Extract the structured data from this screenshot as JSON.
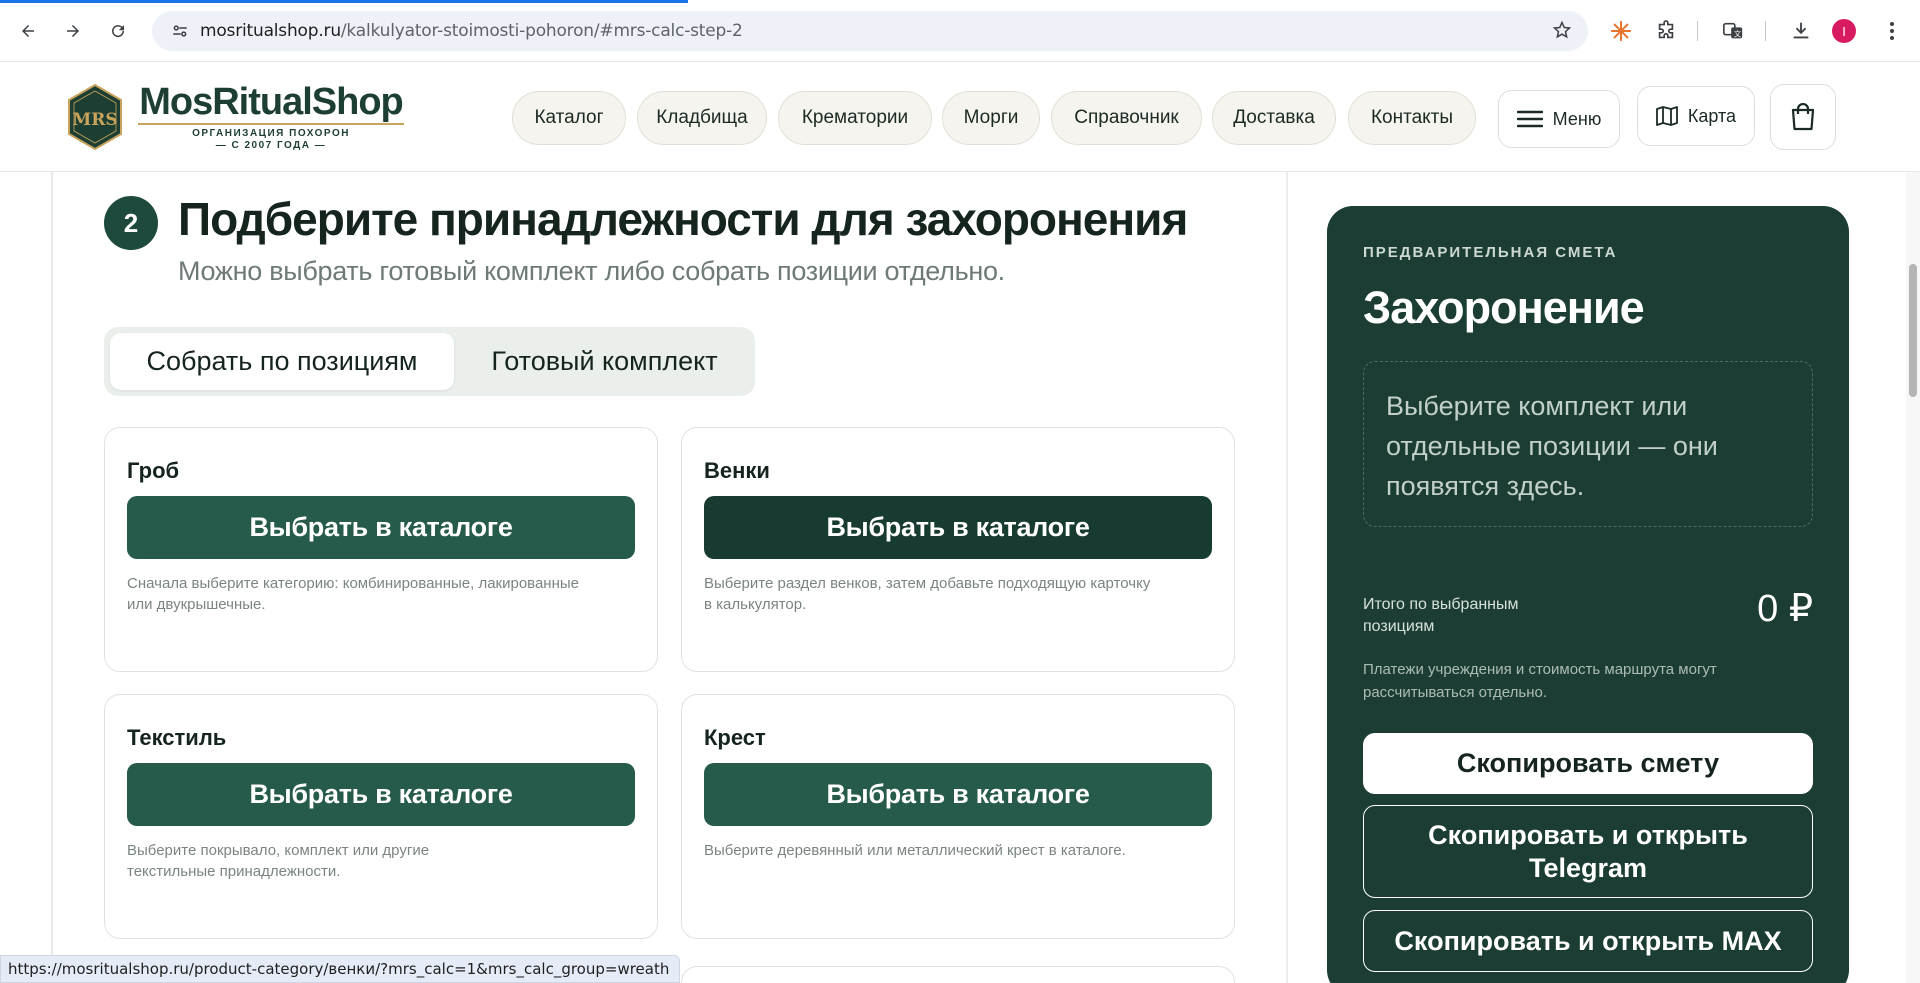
{
  "browser": {
    "url_host": "mosritualshop.ru",
    "url_path": "/kalkulyator-stoimosti-pohoron/#mrs-calc-step-2",
    "profile_initial": "I",
    "status_url": "https://mosritualshop.ru/product-category/венки/?mrs_calc=1&mrs_calc_group=wreath"
  },
  "header": {
    "logo_name": "MosRitualShop",
    "logo_mark": "MRS",
    "logo_sub": "ОРГАНИЗАЦИЯ ПОХОРОН",
    "logo_sub2": "— С 2007 ГОДА —",
    "nav": [
      {
        "label": "Каталог"
      },
      {
        "label": "Кладбища"
      },
      {
        "label": "Крематории"
      },
      {
        "label": "Морги"
      },
      {
        "label": "Справочник"
      },
      {
        "label": "Доставка"
      },
      {
        "label": "Контакты"
      }
    ],
    "menu_label": "Меню",
    "map_label": "Карта"
  },
  "step": {
    "number": "2",
    "title": "Подберите принадлежности для захоронения",
    "subtitle": "Можно выбрать готовый комплект либо собрать позиции отдельно."
  },
  "tabs": [
    {
      "label": "Собрать по позициям",
      "active": true
    },
    {
      "label": "Готовый комплект",
      "active": false
    }
  ],
  "cards": [
    {
      "title": "Гроб",
      "button": "Выбрать в каталоге",
      "desc_1": "Сначала выберите категорию: комбинированные, лакированные",
      "desc_2": "или двукрышечные."
    },
    {
      "title": "Венки",
      "button": "Выбрать в каталоге",
      "desc_1": "Выберите раздел венков, затем добавьте подходящую карточку",
      "desc_2": "в калькулятор."
    },
    {
      "title": "Текстиль",
      "button": "Выбрать в каталоге",
      "desc_1": "Выберите покрывало, комплект или другие",
      "desc_2": "текстильные принадлежности."
    },
    {
      "title": "Крест",
      "button": "Выбрать в каталоге",
      "desc_1": "Выберите деревянный или металлический крест в каталоге.",
      "desc_2": ""
    }
  ],
  "estimate": {
    "eyebrow": "ПРЕДВАРИТЕЛЬНАЯ СМЕТА",
    "title": "Захоронение",
    "empty_text": "Выберите комплект или отдельные позиции — они появятся здесь.",
    "total_label": "Итого по выбранным позициям",
    "total_value": "0 ₽",
    "note": "Платежи учреждения и стоимость маршрута могут рассчитываться отдельно.",
    "btn_copy": "Скопировать смету",
    "btn_telegram": "Скопировать и открыть Telegram",
    "btn_max": "Скопировать и открыть MAX"
  },
  "colors": {
    "brand_green": "#1b3d33",
    "button_green": "#265a4a",
    "gold": "#c9a35b"
  }
}
